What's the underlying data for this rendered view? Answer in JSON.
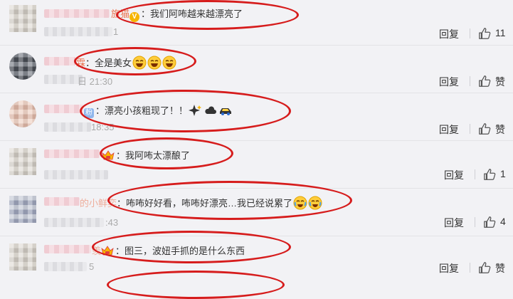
{
  "comments": [
    {
      "user_visible_tail": "旌猫",
      "text": "：我们阿咘越来越漂亮了",
      "time_tail": "1",
      "reply_label": "回复",
      "likes": "11"
    },
    {
      "user_visible_tail": "霖",
      "text": "：全是美女",
      "time_tail": "日 21:30",
      "reply_label": "回复",
      "likes": "赞"
    },
    {
      "user_visible_tail": "粉",
      "text": "：漂亮小孩粗现了！！",
      "time_tail": "18:35",
      "reply_label": "回复",
      "likes": "赞"
    },
    {
      "user_visible_tail": "",
      "text": "：我阿咘太漂酿了",
      "time_tail": "",
      "reply_label": "回复",
      "likes": "1"
    },
    {
      "user_visible_tail": "的小鲜奕",
      "text": "：咘咘好好看，咘咘好漂亮…我已经说累了",
      "time_tail": ":43",
      "reply_label": "回复",
      "likes": "4"
    },
    {
      "user_visible_tail": "羡",
      "text": "：图三，波妞手抓的是什么东西",
      "time_tail": "5",
      "reply_label": "回复",
      "likes": "赞"
    }
  ],
  "colors": {
    "highlight_ellipse": "#d61c1c",
    "background": "#f2f2f5",
    "text": "#333333"
  }
}
